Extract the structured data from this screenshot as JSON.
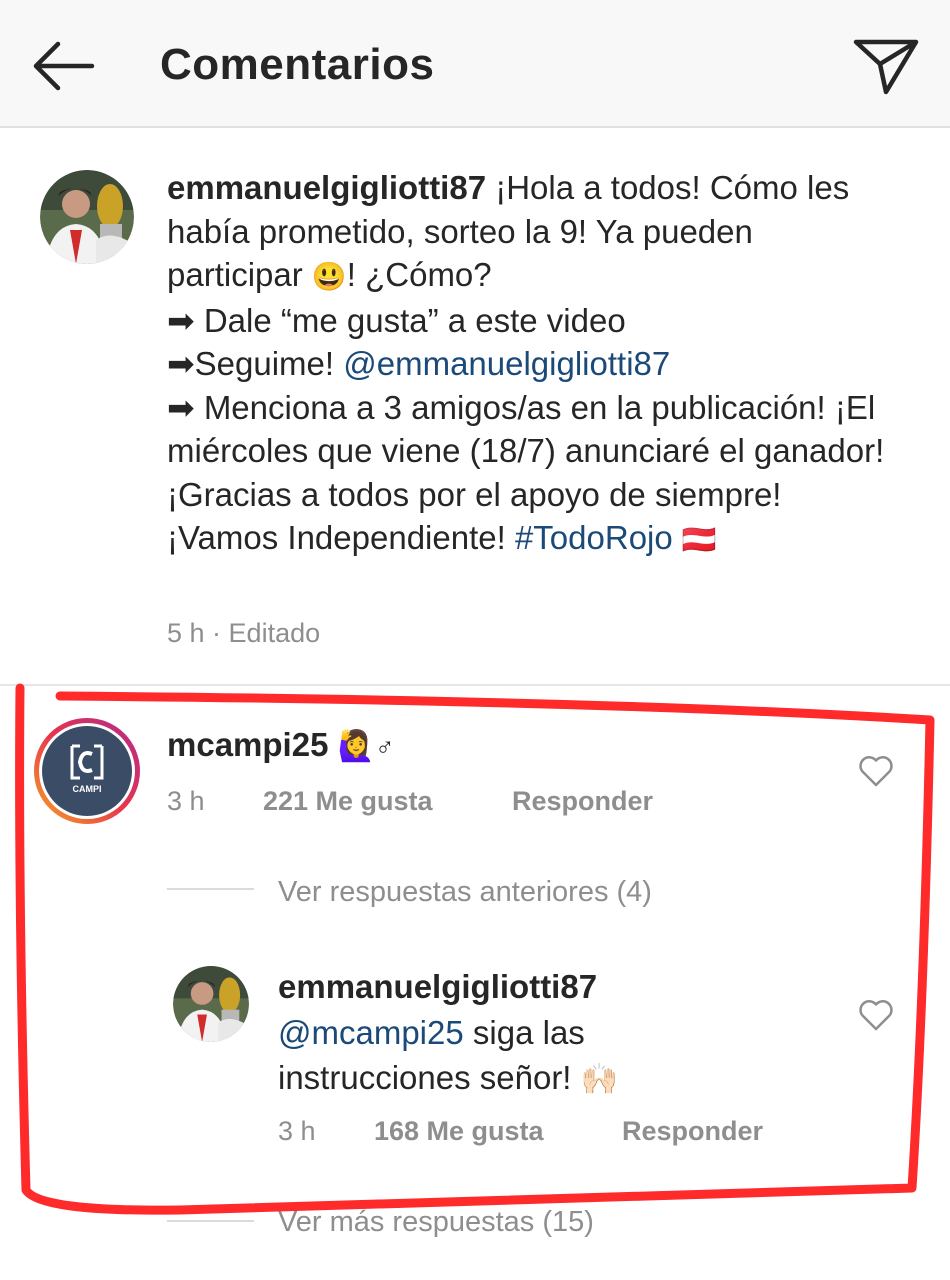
{
  "header": {
    "title": "Comentarios",
    "back_icon": "arrow-left-icon",
    "share_icon": "send-icon"
  },
  "post": {
    "username": "emmanuelgigliotti87",
    "line1": " ¡Hola a todos! Cómo les había prometido, sorteo la 9! Ya pueden participar ",
    "line1_emoji": "😃",
    "line1_tail": "! ¿Cómo?",
    "line2": "➡ Dale “me gusta” a este video",
    "line3_prefix": "➡Seguime! ",
    "line3_mention": "@emmanuelgigliotti87",
    "line4": "➡ Menciona a 3 amigos/as en la publicación! ¡El miércoles que viene (18/7) anunciaré el ganador! ¡Gracias a todos por el apoyo de siempre! ¡Vamos Independiente! ",
    "hashtag": "#TodoRojo",
    "flag_emoji": "🇦🇹",
    "time": "5 h",
    "edited": " · Editado"
  },
  "comment": {
    "username": "mcampi25",
    "emoji": "🙋‍♀",
    "emoji_sign": "♂",
    "time": "3 h",
    "likes": "221 Me gusta",
    "reply": "Responder",
    "avatar_label": "CAMPI"
  },
  "thread": {
    "previous_label": "Ver respuestas anteriores (4)",
    "more_label": "Ver más respuestas (15)"
  },
  "reply": {
    "username": "emmanuelgigliotti87",
    "mention": "@mcampi25",
    "text1": " siga las",
    "text2": "instrucciones señor! ",
    "emoji": "🙌🏻",
    "time": "3 h",
    "likes": "168 Me gusta",
    "reply": "Responder"
  },
  "colors": {
    "mention": "#1b4a78",
    "meta": "#8e8e8e",
    "annotation": "#ff2a2a"
  }
}
